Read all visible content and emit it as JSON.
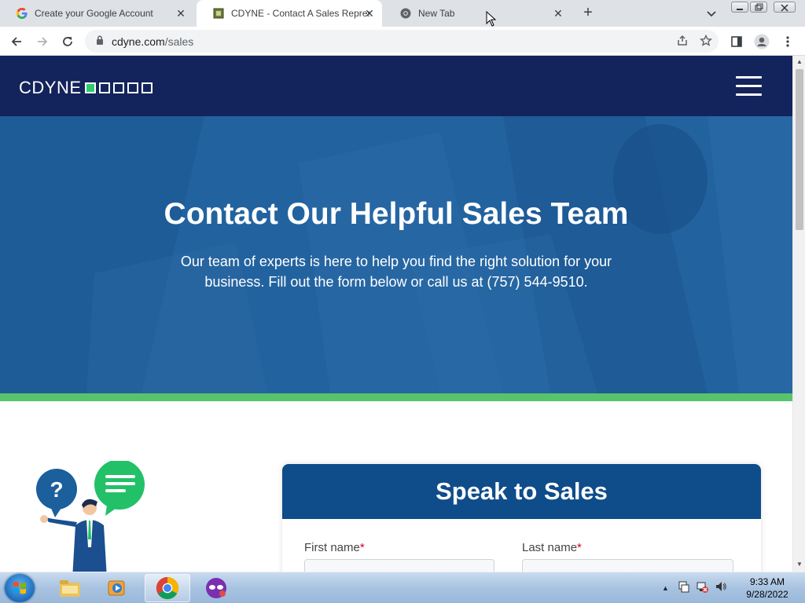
{
  "browser": {
    "tabs": [
      {
        "title": "Create your Google Account",
        "favicon": "google-icon",
        "active": false
      },
      {
        "title": "CDYNE - Contact A Sales Represe",
        "favicon": "cdyne-icon",
        "active": true
      },
      {
        "title": "New Tab",
        "favicon": "chrome-icon",
        "active": false
      }
    ],
    "new_tab_symbol": "+",
    "close_symbol": "✕",
    "url_host": "cdyne.com",
    "url_path": "/sales"
  },
  "site": {
    "logo_text": "CDYNE",
    "hero": {
      "title": "Contact Our Helpful Sales Team",
      "body": "Our team of experts is here to help you find the right solution for your business. Fill out the form below or call us at (757) 544-9510."
    },
    "form": {
      "title": "Speak to Sales",
      "first_name_label": "First name",
      "last_name_label": "Last name",
      "required_mark": "*"
    },
    "colors": {
      "nav": "#13235b",
      "hero": "#22639f",
      "accent_green": "#57c46b",
      "card_header": "#0f4c8a"
    }
  },
  "taskbar": {
    "time": "9:33 AM",
    "date": "9/28/2022"
  }
}
